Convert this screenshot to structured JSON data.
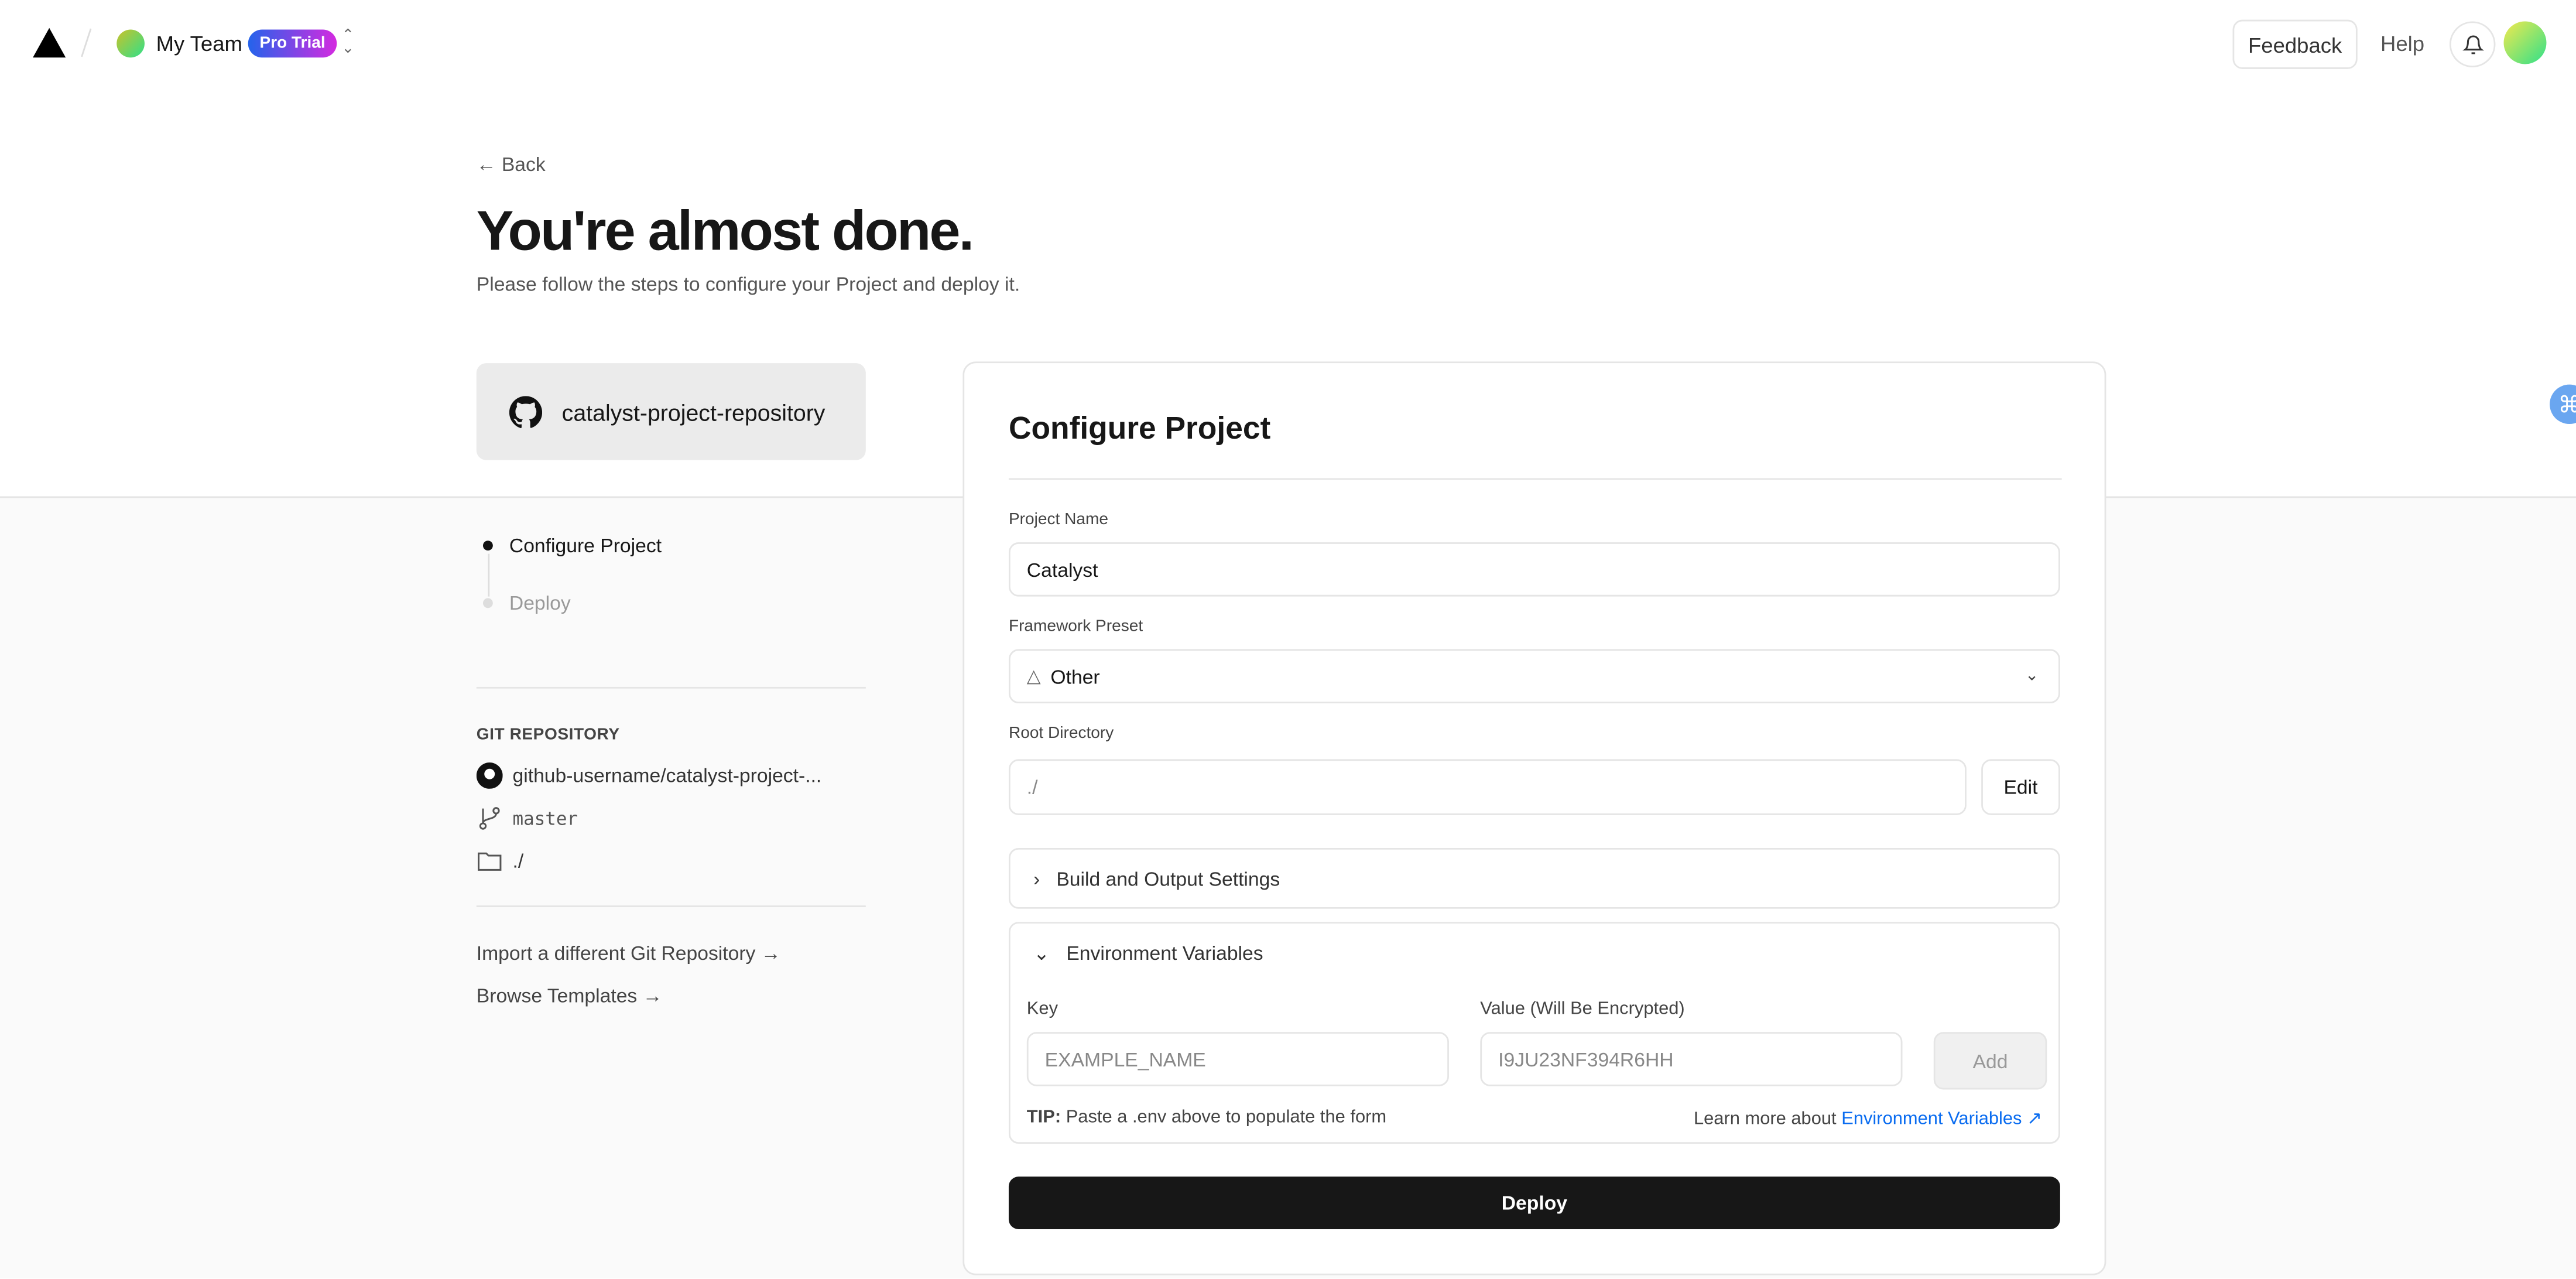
{
  "header": {
    "team_name": "My Team",
    "plan_badge": "Pro Trial",
    "feedback": "Feedback",
    "help": "Help"
  },
  "page": {
    "back": "Back",
    "title": "You're almost done.",
    "subtitle": "Please follow the steps to configure your Project and deploy it."
  },
  "repo_card": {
    "name": "catalyst-project-repository"
  },
  "steps": [
    {
      "label": "Configure Project",
      "active": true
    },
    {
      "label": "Deploy",
      "active": false
    }
  ],
  "git": {
    "heading": "GIT REPOSITORY",
    "repo": "github-username/catalyst-project-...",
    "branch": "master",
    "directory": "./"
  },
  "links": {
    "import": "Import a different Git Repository →",
    "templates": "Browse Templates →"
  },
  "configure": {
    "title": "Configure Project",
    "project_name_label": "Project Name",
    "project_name": "Catalyst",
    "framework_label": "Framework Preset",
    "framework": "Other",
    "root_label": "Root Directory",
    "root": "./",
    "edit": "Edit",
    "build_settings": "Build and Output Settings",
    "env": {
      "title": "Environment Variables",
      "key_label": "Key",
      "value_label": "Value (Will Be Encrypted)",
      "key_placeholder": "EXAMPLE_NAME",
      "value_placeholder": "I9JU23NF394R6HH",
      "add": "Add",
      "tip_bold": "TIP:",
      "tip": "Paste a .env above to populate the form",
      "learn": "Learn more about",
      "learn_link": "Environment Variables"
    },
    "deploy": "Deploy"
  }
}
